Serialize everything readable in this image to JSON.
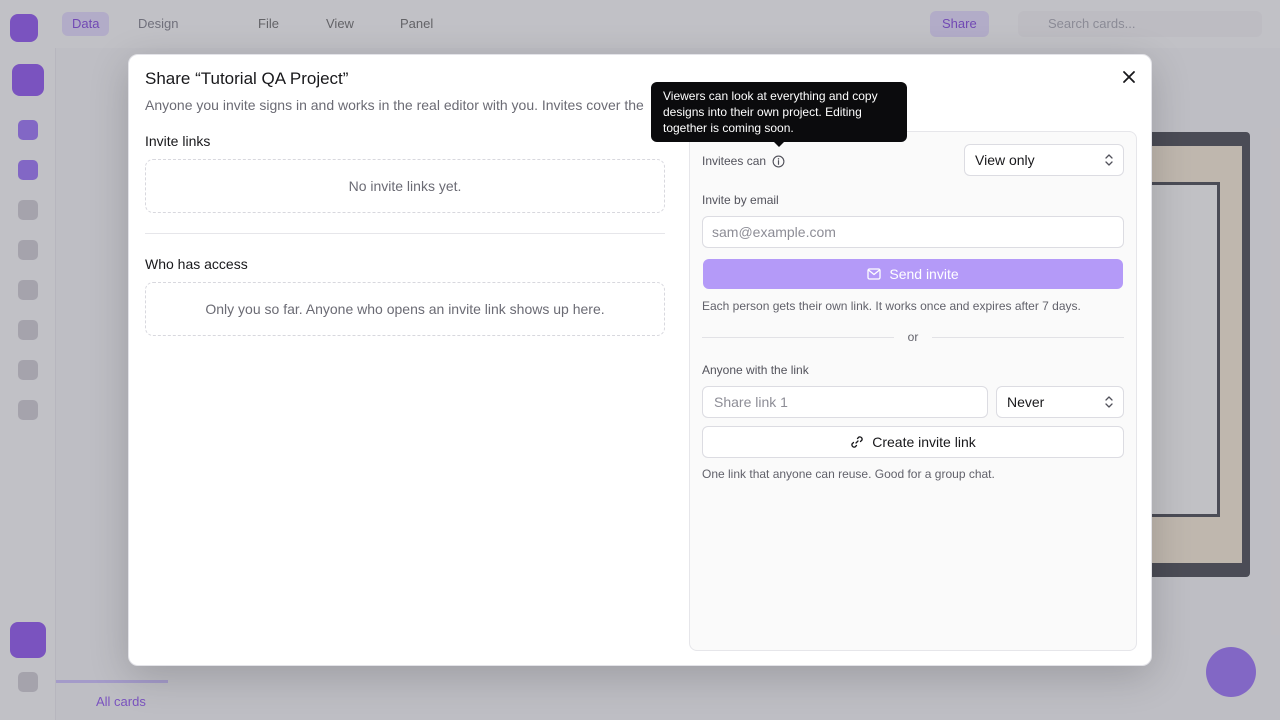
{
  "background": {
    "modes": [
      "Data",
      "Design"
    ],
    "menu": [
      "File",
      "View",
      "Panel"
    ],
    "share_label": "Share",
    "search_placeholder": "Search cards...",
    "bottom_tab": "All cards"
  },
  "modal": {
    "title": "Share “Tutorial QA Project”",
    "description": "Anyone you invite signs in and works in the real editor with you. Invites cover the",
    "invite_links": {
      "label": "Invite links",
      "empty": "No invite links yet."
    },
    "access": {
      "label": "Who has access",
      "empty": "Only you so far. Anyone who opens an invite link shows up here."
    },
    "panel": {
      "invitees_label": "Invitees can",
      "permission_value": "View only",
      "email_label": "Invite by email",
      "email_placeholder": "sam@example.com",
      "send_label": "Send invite",
      "email_hint": "Each person gets their own link. It works once and expires after 7 days.",
      "or_label": "or",
      "link_label": "Anyone with the link",
      "link_name_placeholder": "Share link 1",
      "expiry_value": "Never",
      "create_label": "Create invite link",
      "link_hint": "One link that anyone can reuse. Good for a group chat."
    },
    "tooltip": "Viewers can look at everything and copy designs into their own project. Editing together is coming soon."
  },
  "colors": {
    "accent": "#7c3aed",
    "send_button": "#b49af8",
    "tooltip_bg": "#0b0b0d"
  }
}
